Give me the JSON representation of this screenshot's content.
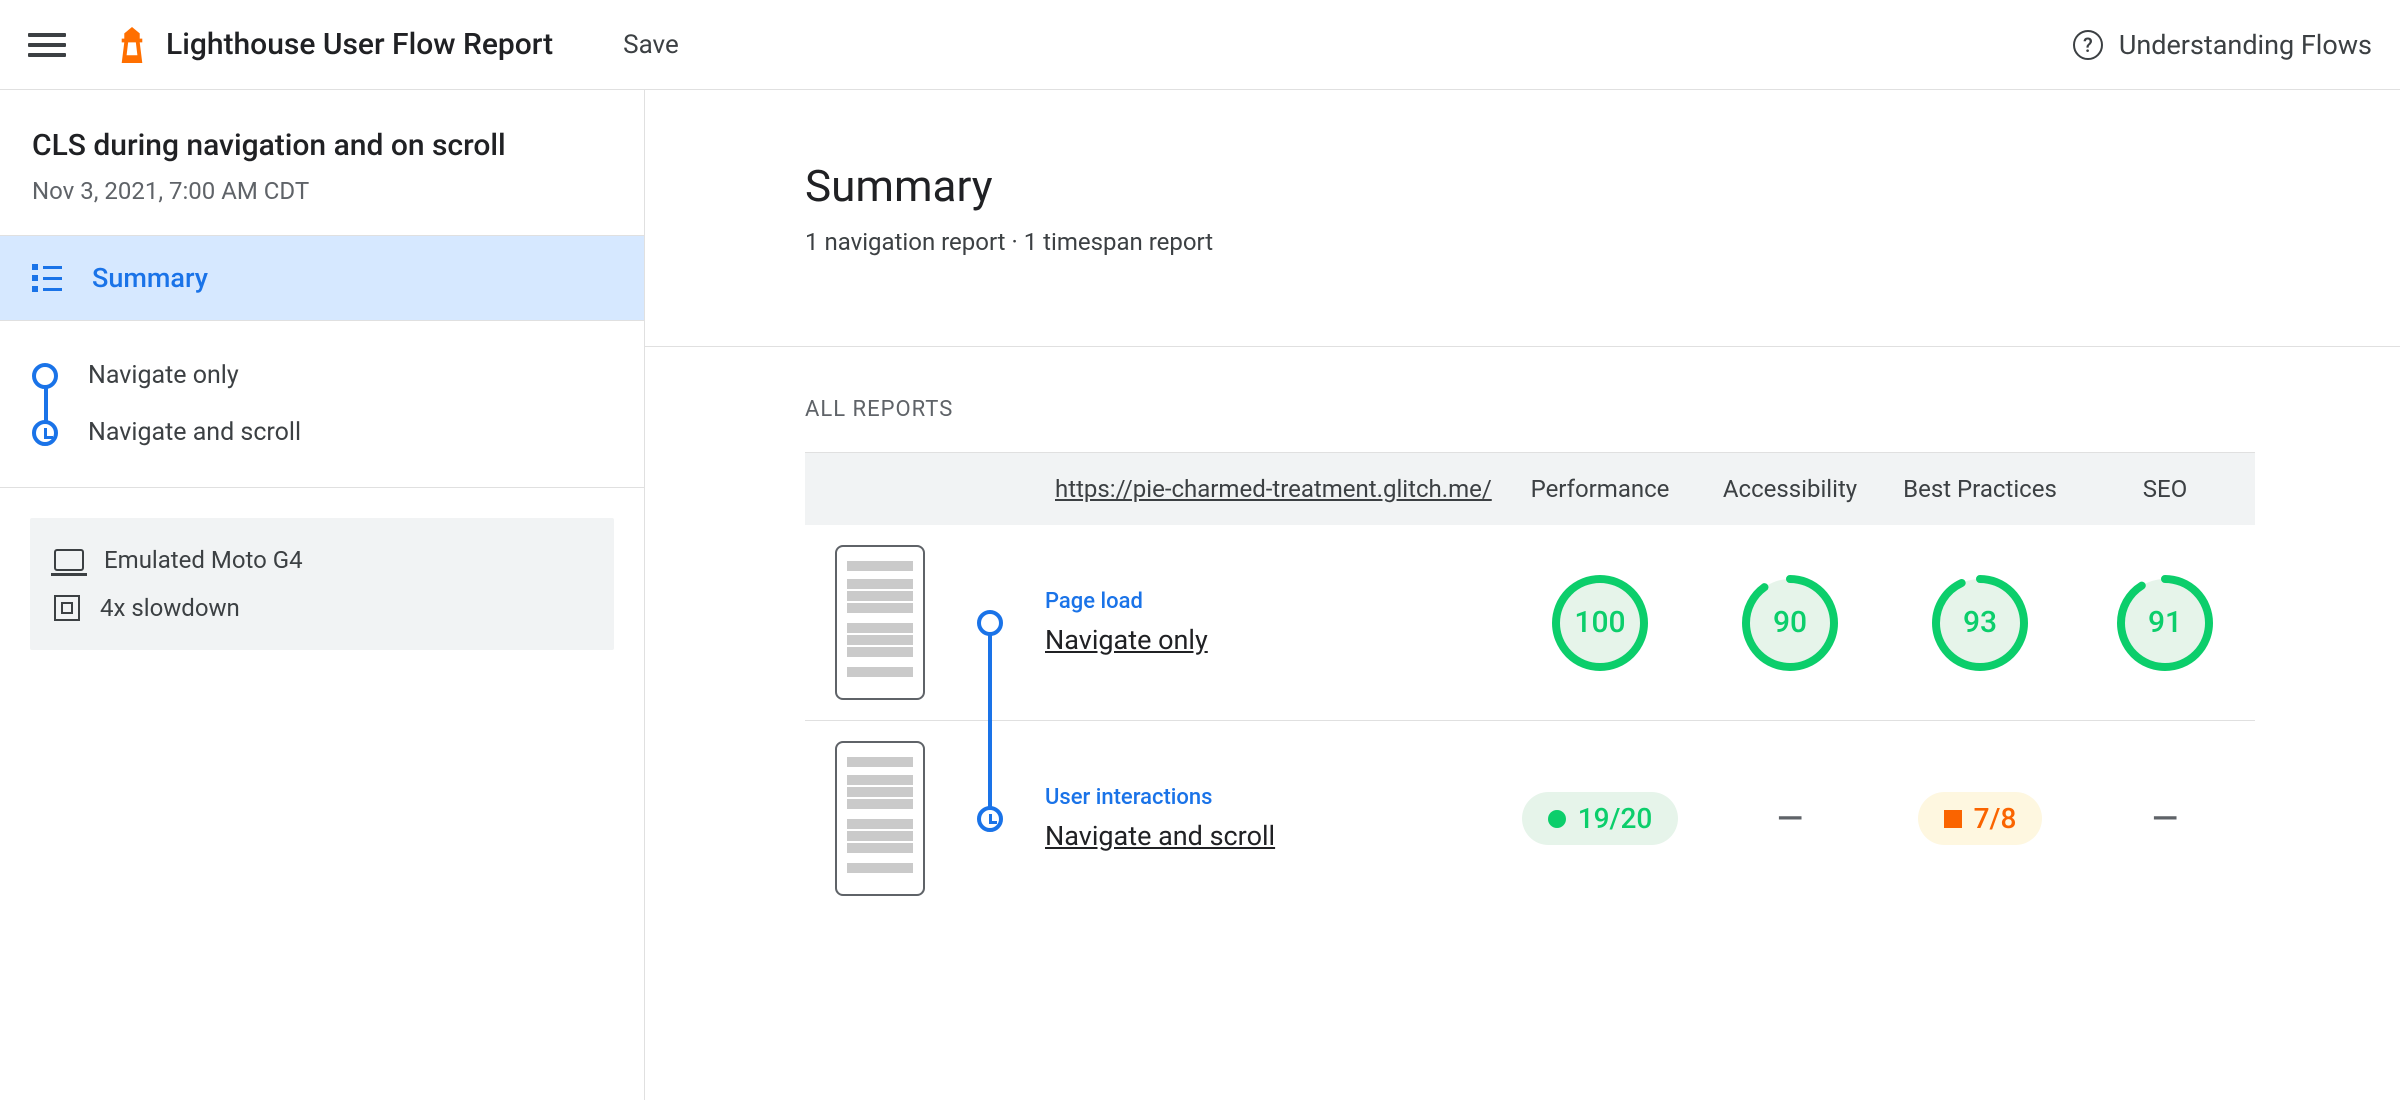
{
  "header": {
    "app_title": "Lighthouse User Flow Report",
    "save": "Save",
    "help": "Understanding Flows"
  },
  "sidebar": {
    "flow_name": "CLS during navigation and on scroll",
    "date": "Nov 3, 2021, 7:00 AM CDT",
    "summary_label": "Summary",
    "steps": [
      {
        "label": "Navigate only",
        "kind": "navigation"
      },
      {
        "label": "Navigate and scroll",
        "kind": "timespan"
      }
    ],
    "env": {
      "device": "Emulated Moto G4",
      "cpu": "4x slowdown"
    }
  },
  "summary": {
    "title": "Summary",
    "subtitle": "1 navigation report · 1 timespan report",
    "all_reports_label": "All Reports",
    "url": "https://pie-charmed-treatment.glitch.me/",
    "columns": [
      "Performance",
      "Accessibility",
      "Best Practices",
      "SEO"
    ],
    "rows": [
      {
        "kind": "navigation",
        "type_label": "Page load",
        "name": "Navigate only",
        "scores": {
          "performance": 100,
          "accessibility": 90,
          "best_practices": 93,
          "seo": 91
        }
      },
      {
        "kind": "timespan",
        "type_label": "User interactions",
        "name": "Navigate and scroll",
        "fractions": {
          "performance": {
            "text": "19/20",
            "rating": "pass"
          },
          "accessibility": null,
          "best_practices": {
            "text": "7/8",
            "rating": "average"
          },
          "seo": null
        }
      }
    ]
  },
  "colors": {
    "pass": "#0cce6b",
    "average": "#ffa400",
    "blue": "#1a73e8"
  }
}
